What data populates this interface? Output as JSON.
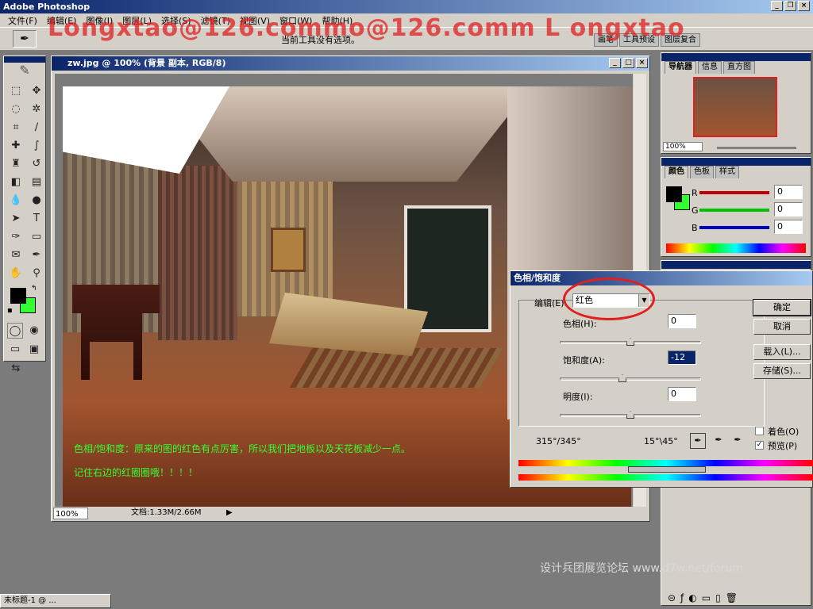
{
  "app": {
    "title": "Adobe Photoshop",
    "watermark": "Longxtao@126.commo@126.comm L ongxtao"
  },
  "menu": [
    "文件(F)",
    "编辑(E)",
    "图像(I)",
    "图层(L)",
    "选择(S)",
    "滤镜(T)",
    "视图(V)",
    "窗口(W)",
    "帮助(H)"
  ],
  "options": {
    "message": "当前工具没有选项。",
    "palette_well": [
      "画笔",
      "工具预设",
      "图层复合"
    ]
  },
  "document": {
    "title": "zw.jpg @ 100% (背景 副本, RGB/8)",
    "zoom": "100%",
    "doc_size": "文档:1.33M/2.66M",
    "annotation_line1": "色相/饱和度：原来的图的红色有点厉害，所以我们把地板以及天花板减少一点。",
    "annotation_line2": "记住右边的红圈圈哦！！！！"
  },
  "navigator": {
    "tabs": [
      "导航器",
      "信息",
      "直方图"
    ],
    "zoom": "100%"
  },
  "color_panel": {
    "tabs": [
      "颜色",
      "色板",
      "样式"
    ],
    "labels": [
      "R",
      "G",
      "B"
    ],
    "values": [
      "0",
      "0",
      "0"
    ],
    "colors": {
      "red": "#c00000",
      "green": "#00c000",
      "blue": "#0000c0"
    }
  },
  "dialog": {
    "title": "色相/饱和度",
    "edit_label": "编辑(E):",
    "edit_value": "红色",
    "hue_label": "色相(H):",
    "hue_value": "0",
    "saturation_label": "饱和度(A):",
    "saturation_value": "-12",
    "lightness_label": "明度(I):",
    "lightness_value": "0",
    "ok": "确定",
    "cancel": "取消",
    "load": "载入(L)...",
    "save": "存储(S)...",
    "colorize": "着色(O)",
    "preview": "预览(P)",
    "range_left": "315°/345°",
    "range_right": "15°\\45°",
    "highlight": "#e02020"
  },
  "taskbar": {
    "item": "未标题-1 @ ..."
  },
  "forum": "设计兵团展览论坛 www.d7w.net/forum",
  "colors": {
    "fg": "#000000",
    "bg": "#33ff33",
    "title": "#0a246a"
  }
}
